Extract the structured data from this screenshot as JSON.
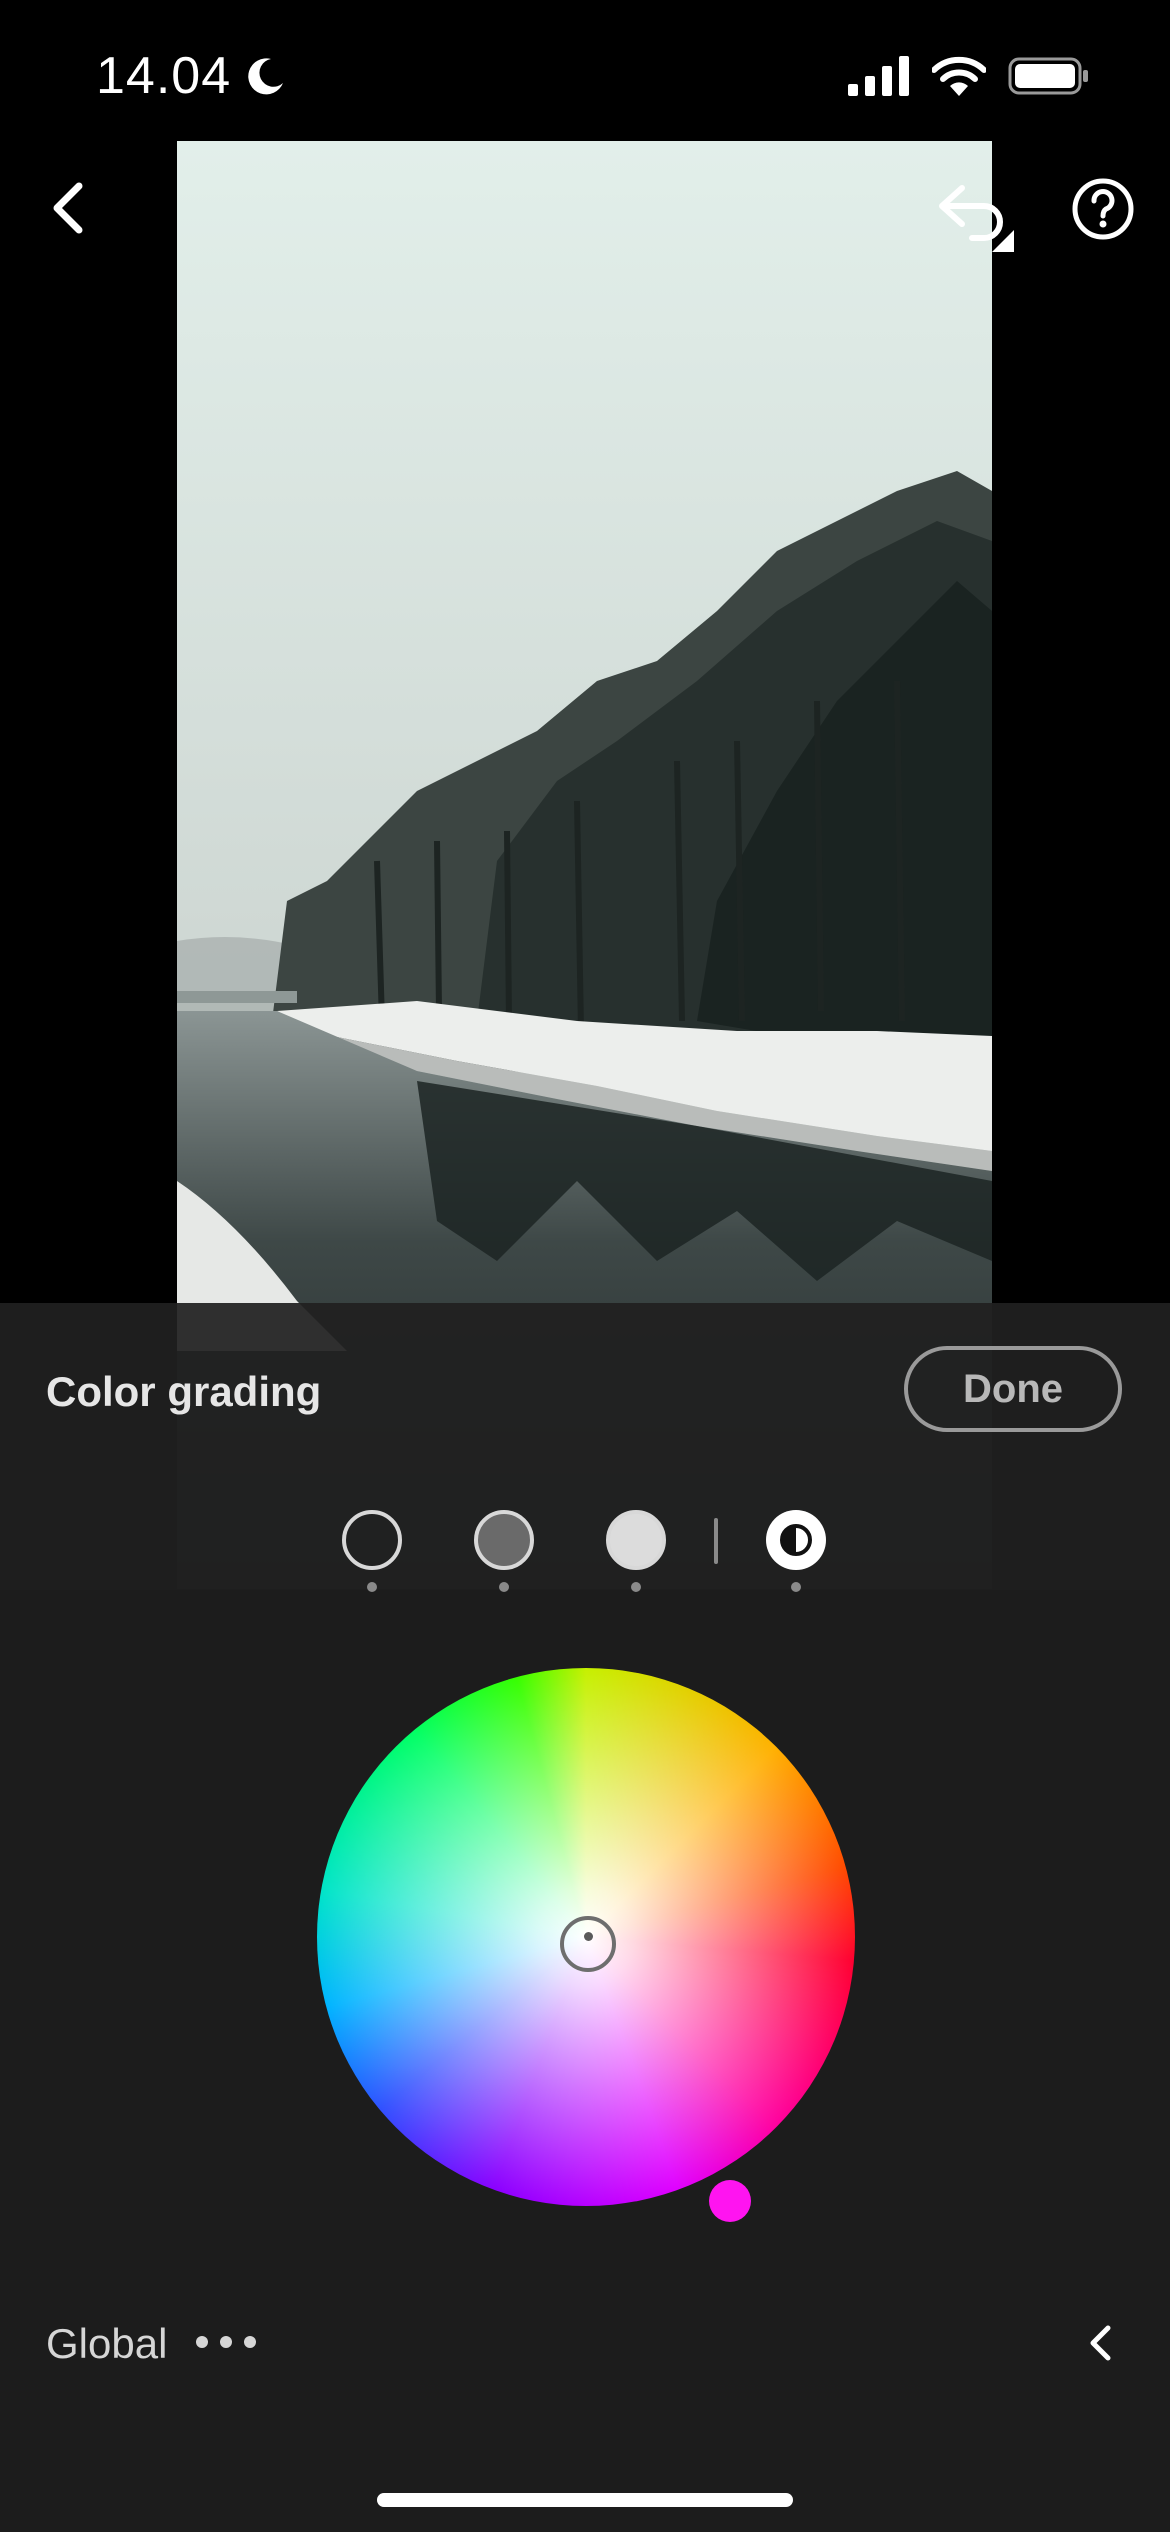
{
  "status_bar": {
    "time": "14.04",
    "moon_icon": "moon-icon",
    "signal_icon": "cellular-signal-icon",
    "wifi_icon": "wifi-icon",
    "battery_icon": "battery-icon"
  },
  "top_bar": {
    "back_icon": "chevron-left-icon",
    "undo_icon": "undo-icon",
    "help_icon": "help-circle-icon"
  },
  "photo": {
    "subject": "snowy riverbank with trees in fog"
  },
  "panel": {
    "title": "Color grading",
    "done_label": "Done",
    "tones": [
      {
        "name": "shadows",
        "icon": "shadows-circle-icon"
      },
      {
        "name": "midtones",
        "icon": "midtones-circle-icon"
      },
      {
        "name": "highlights",
        "icon": "highlights-circle-icon"
      },
      {
        "name": "global",
        "icon": "global-contrast-icon",
        "selected": true
      }
    ],
    "wheel": {
      "hue_handle_color": "#ff14f0"
    },
    "mode_label": "Global",
    "more_icon": "more-dots-icon",
    "collapse_icon": "chevron-left-icon"
  },
  "colors": {
    "background": "#000000",
    "panel": "#1c1c1c",
    "accent_handle": "#ff14f0"
  }
}
